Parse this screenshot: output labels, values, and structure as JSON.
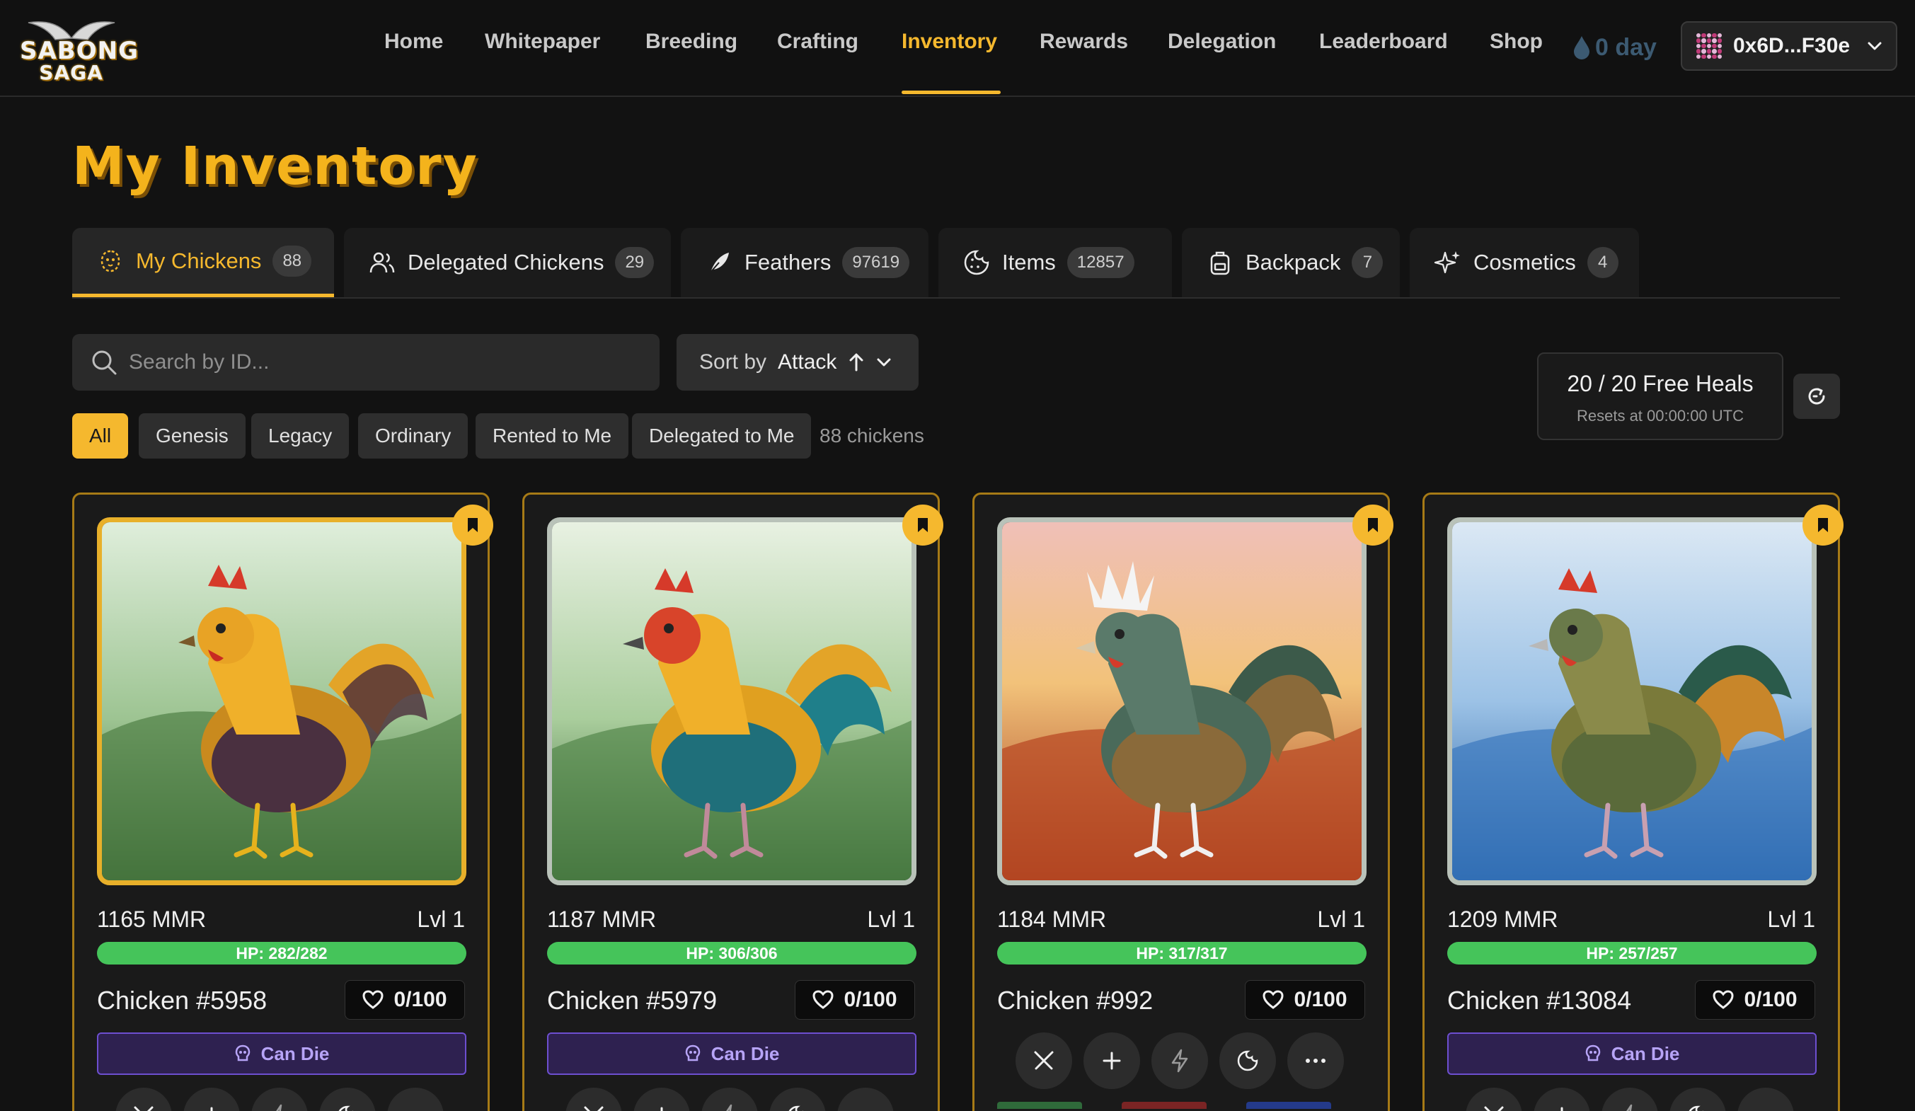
{
  "brand": {
    "line1": "SABONG",
    "line2": "SAGA"
  },
  "nav": {
    "links": [
      "Home",
      "Whitepaper",
      "Breeding",
      "Crafting",
      "Inventory",
      "Rewards",
      "Delegation",
      "Leaderboard",
      "Shop"
    ],
    "active": "Inventory",
    "streak": "0 day",
    "wallet": "0x6D...F30e"
  },
  "page": {
    "title": "My Inventory"
  },
  "tabs": [
    {
      "label": "My Chickens",
      "count": "88",
      "icon": "chicken-icon"
    },
    {
      "label": "Delegated Chickens",
      "count": "29",
      "icon": "users-icon"
    },
    {
      "label": "Feathers",
      "count": "97619",
      "icon": "feather-icon"
    },
    {
      "label": "Items",
      "count": "12857",
      "icon": "cookie-icon"
    },
    {
      "label": "Backpack",
      "count": "7",
      "icon": "backpack-icon"
    },
    {
      "label": "Cosmetics",
      "count": "4",
      "icon": "sparkles-icon"
    }
  ],
  "search": {
    "placeholder": "Search by ID..."
  },
  "sort": {
    "label": "Sort by",
    "value": "Attack"
  },
  "filters": [
    "All",
    "Genesis",
    "Legacy",
    "Ordinary",
    "Rented to Me",
    "Delegated to Me"
  ],
  "filter_count": "88 chickens",
  "heals": {
    "title": "20 / 20 Free Heals",
    "subtitle": "Resets at 00:00:00 UTC"
  },
  "cards": [
    {
      "mmr": "1165 MMR",
      "level": "Lvl 1",
      "hp": "HP: 282/282",
      "name": "Chicken #5958",
      "hearts": "0/100",
      "status": "Can Die"
    },
    {
      "mmr": "1187 MMR",
      "level": "Lvl 1",
      "hp": "HP: 306/306",
      "name": "Chicken #5979",
      "hearts": "0/100",
      "status": "Can Die"
    },
    {
      "mmr": "1184 MMR",
      "level": "Lvl 1",
      "hp": "HP: 317/317",
      "name": "Chicken #992",
      "hearts": "0/100",
      "status": ""
    },
    {
      "mmr": "1209 MMR",
      "level": "Lvl 1",
      "hp": "HP: 257/257",
      "name": "Chicken #13084",
      "hearts": "0/100",
      "status": "Can Die"
    }
  ],
  "colors": {
    "accent": "#f5b82e",
    "hp": "#45c45a",
    "can_die": "#6d4fd0"
  }
}
